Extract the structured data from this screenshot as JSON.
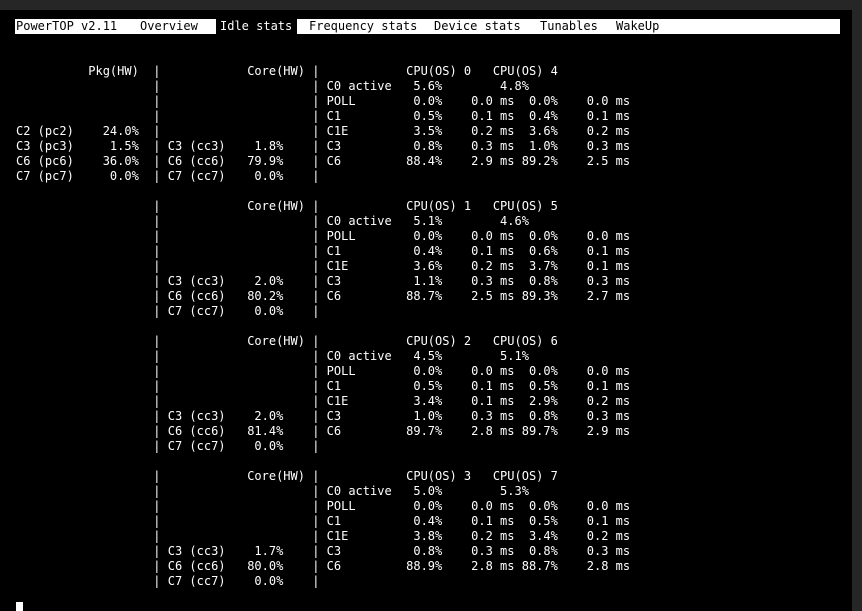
{
  "menu": {
    "title": "PowerTOP v2.11",
    "tabs": [
      "Overview",
      "Idle stats",
      "Frequency stats",
      "Device stats",
      "Tunables",
      "WakeUp"
    ],
    "active_tab": "Idle stats"
  },
  "lines": [
    "          Pkg(HW)  |            Core(HW) |            CPU(OS) 0   CPU(OS) 4",
    "                   |                     | C0 active   5.6%        4.8%",
    "                   |                     | POLL        0.0%    0.0 ms  0.0%    0.0 ms",
    "                   |                     | C1          0.5%    0.1 ms  0.4%    0.1 ms",
    "C2 (pc2)    24.0%  |                     | C1E         3.5%    0.2 ms  3.6%    0.2 ms",
    "C3 (pc3)     1.5%  | C3 (cc3)    1.8%    | C3          0.8%    0.3 ms  1.0%    0.3 ms",
    "C6 (pc6)    36.0%  | C6 (cc6)   79.9%    | C6         88.4%    2.9 ms 89.2%    2.5 ms",
    "C7 (pc7)     0.0%  | C7 (cc7)    0.0%    |",
    "",
    "                   |            Core(HW) |            CPU(OS) 1   CPU(OS) 5",
    "                   |                     | C0 active   5.1%        4.6%",
    "                   |                     | POLL        0.0%    0.0 ms  0.0%    0.0 ms",
    "                   |                     | C1          0.4%    0.1 ms  0.6%    0.1 ms",
    "                   |                     | C1E         3.6%    0.2 ms  3.7%    0.1 ms",
    "                   | C3 (cc3)    2.0%    | C3          1.1%    0.3 ms  0.8%    0.3 ms",
    "                   | C6 (cc6)   80.2%    | C6         88.7%    2.5 ms 89.3%    2.7 ms",
    "                   | C7 (cc7)    0.0%    |",
    "",
    "                   |            Core(HW) |            CPU(OS) 2   CPU(OS) 6",
    "                   |                     | C0 active   4.5%        5.1%",
    "                   |                     | POLL        0.0%    0.0 ms  0.0%    0.0 ms",
    "                   |                     | C1          0.5%    0.1 ms  0.5%    0.1 ms",
    "                   |                     | C1E         3.4%    0.1 ms  2.9%    0.2 ms",
    "                   | C3 (cc3)    2.0%    | C3          1.0%    0.3 ms  0.8%    0.3 ms",
    "                   | C6 (cc6)   81.4%    | C6         89.7%    2.8 ms 89.7%    2.9 ms",
    "                   | C7 (cc7)    0.0%    |",
    "",
    "                   |            Core(HW) |            CPU(OS) 3   CPU(OS) 7",
    "                   |                     | C0 active   5.0%        5.3%",
    "                   |                     | POLL        0.0%    0.0 ms  0.0%    0.0 ms",
    "                   |                     | C1          0.4%    0.1 ms  0.5%    0.1 ms",
    "                   |                     | C1E         3.8%    0.2 ms  3.4%    0.2 ms",
    "                   | C3 (cc3)    1.7%    | C3          0.8%    0.3 ms  0.8%    0.3 ms",
    "                   | C6 (cc6)   80.0%    | C6         88.9%    2.8 ms 88.7%    2.8 ms",
    "                   | C7 (cc7)    0.0%    |"
  ]
}
